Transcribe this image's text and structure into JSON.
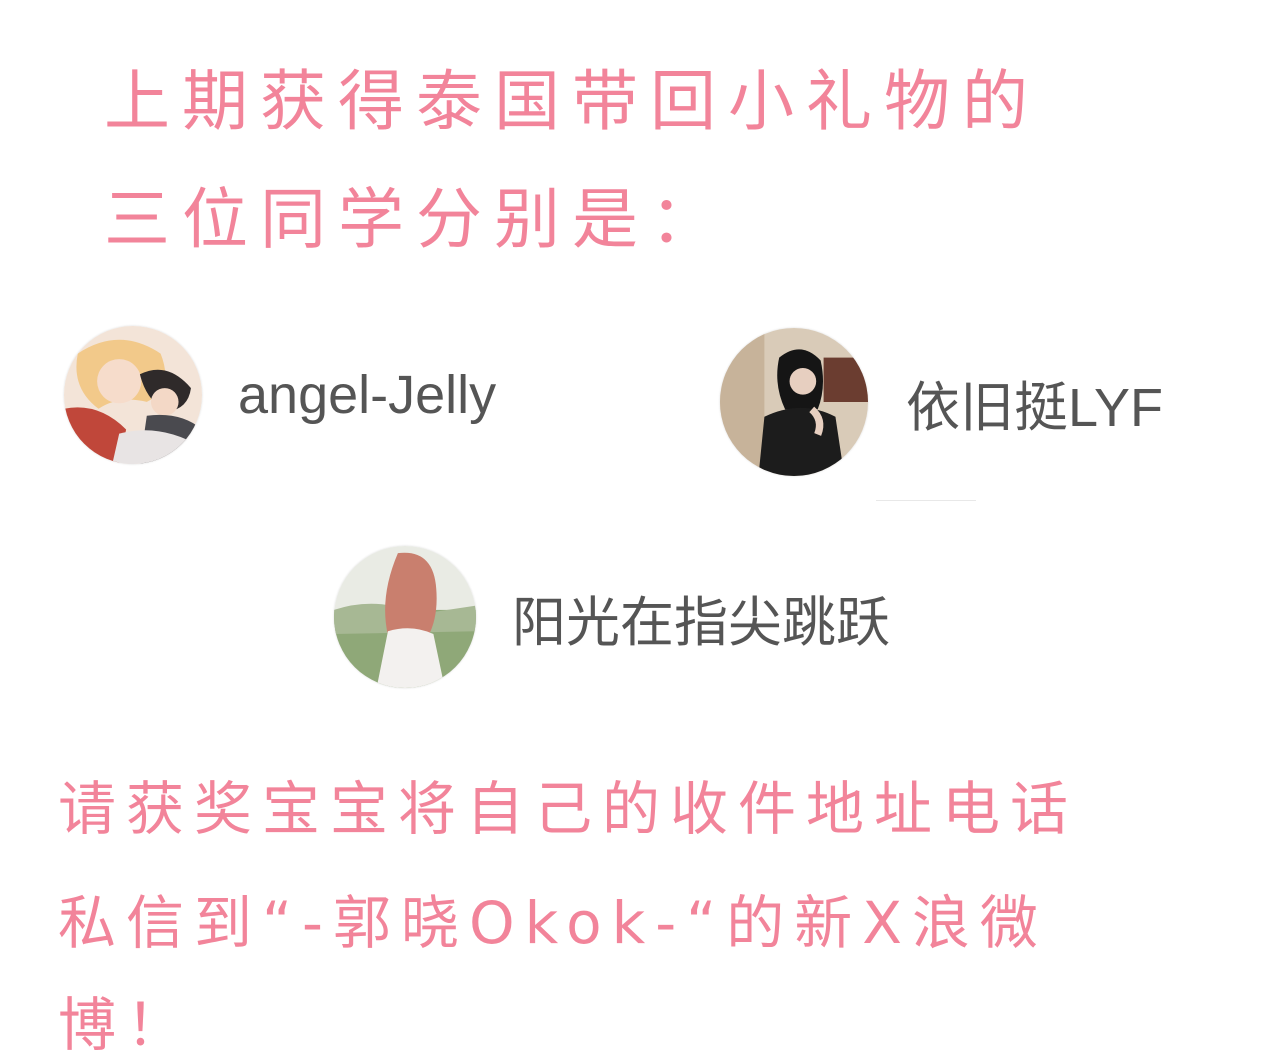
{
  "heading": {
    "line1": "上期获得泰国带回小礼物的",
    "line2": "三位同学分别是："
  },
  "winners": [
    {
      "name": "angel-Jelly",
      "avatar_icon": "anime-couple-avatar"
    },
    {
      "name": "依旧挺LYF",
      "avatar_icon": "woman-black-hair-avatar"
    },
    {
      "name": "阳光在指尖跳跃",
      "avatar_icon": "girl-field-avatar"
    }
  ],
  "footer": {
    "line1": "请获奖宝宝将自己的收件地址电话",
    "line2": "私信到“-郭晓Okok-“的新X浪微",
    "line3": "博！"
  },
  "colors": {
    "accent_pink": "#f2849a",
    "name_gray": "#555555"
  }
}
